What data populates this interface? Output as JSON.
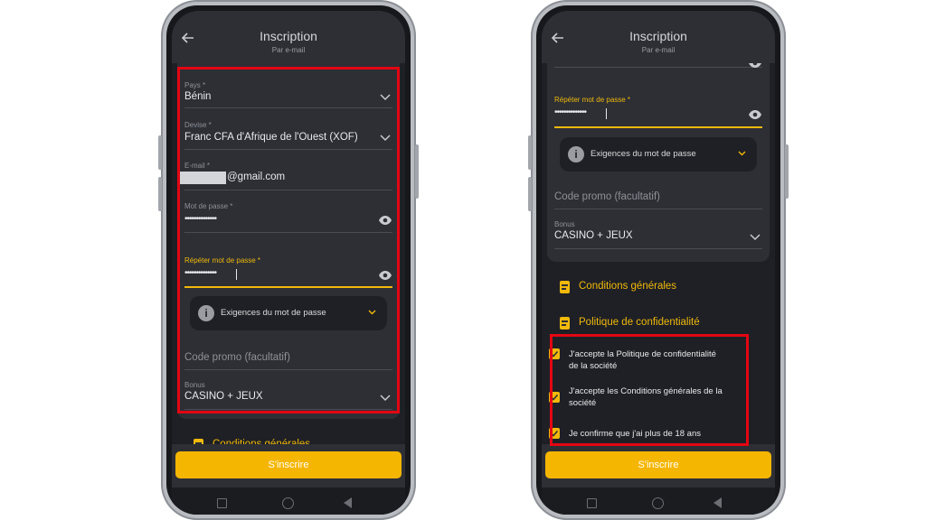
{
  "colors": {
    "accent": "#f0b90b",
    "highlight": "#e30613",
    "button": "#f5b602"
  },
  "phone1": {
    "header": {
      "title": "Inscription",
      "subtitle": "Par e-mail",
      "back_icon": "arrow-left-icon"
    },
    "country": {
      "label": "Pays *",
      "value": "Bénin"
    },
    "currency": {
      "label": "Devise *",
      "value": "Franc CFA d'Afrique de l'Ouest (XOF)"
    },
    "email": {
      "label": "E-mail *",
      "value": "@gmail.com"
    },
    "password": {
      "label": "Mot de passe *",
      "value": "••••••••••••••"
    },
    "repeat_password": {
      "label": "Répéter mot de passe *",
      "value": "••••••••••••••"
    },
    "requirements": {
      "label": "Exigences du mot de passe"
    },
    "promo": {
      "placeholder": "Code promo (facultatif)"
    },
    "bonus": {
      "label": "Bonus",
      "value": "CASINO + JEUX"
    },
    "conditions_link": "Conditions générales",
    "signup_button": "S'inscrire"
  },
  "phone2": {
    "header": {
      "title": "Inscription",
      "subtitle": "Par e-mail",
      "back_icon": "arrow-left-icon"
    },
    "repeat_password": {
      "label": "Répéter mot de passe *",
      "value": "••••••••••••••"
    },
    "requirements": {
      "label": "Exigences du mot de passe"
    },
    "promo": {
      "placeholder": "Code promo (facultatif)"
    },
    "bonus": {
      "label": "Bonus",
      "value": "CASINO + JEUX"
    },
    "conditions_link": "Conditions générales",
    "privacy_link": "Politique de confidentialité",
    "checkboxes": [
      {
        "label": "J'accepte la Politique de confidentialité de la société",
        "checked": true
      },
      {
        "label": "J'accepte les Conditions générales de la société",
        "checked": true
      },
      {
        "label": "Je confirme que j'ai plus de 18 ans",
        "checked": true
      }
    ],
    "signup_button": "S'inscrire"
  }
}
